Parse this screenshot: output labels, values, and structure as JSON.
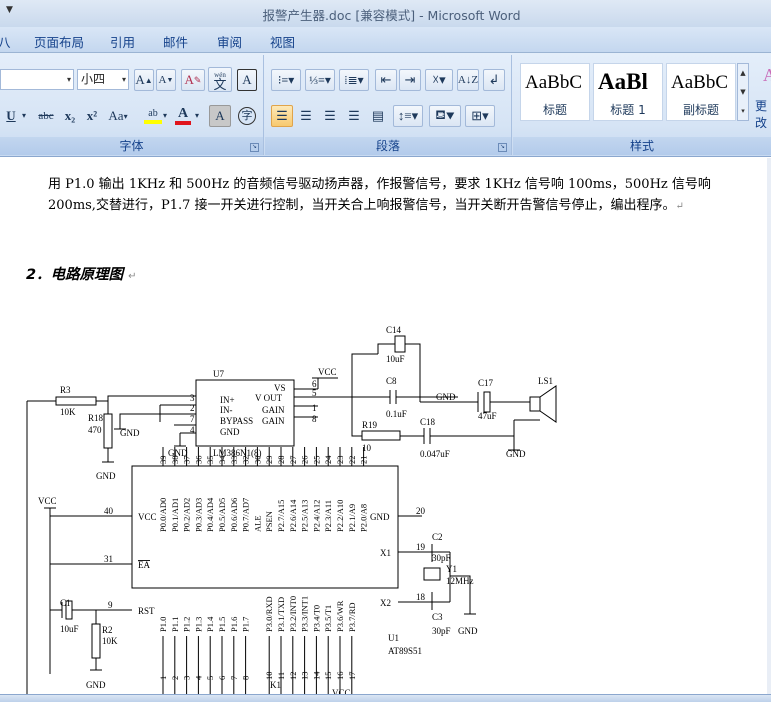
{
  "window": {
    "title": "报警产生器.doc [兼容模式] - Microsoft Word"
  },
  "tabs": [
    "页面布局",
    "引用",
    "邮件",
    "审阅",
    "视图"
  ],
  "ribbon": {
    "font": {
      "label": "字体",
      "size_value": "小四",
      "grow_label": "A",
      "shrink_label": "A",
      "clear_label": "A",
      "phonetic_label": "wén",
      "phonetic_char": "文",
      "border_char_label": "A",
      "underline_label": "U",
      "strike_label": "abc",
      "subscript_label": "x₂",
      "superscript_label": "x²",
      "case_label": "Aa",
      "highlight_label": "ab",
      "fontcolor_label": "A",
      "shade_label": "A",
      "enclose_label": "字"
    },
    "paragraph": {
      "label": "段落"
    },
    "styles": {
      "label": "样式",
      "items": [
        {
          "sample": "AaBbC",
          "name": "标题"
        },
        {
          "sample": "AaBl",
          "name": "标题 1"
        },
        {
          "sample": "AaBbC",
          "name": "副标题"
        }
      ],
      "change_label": "更改"
    }
  },
  "document": {
    "paragraph1": "用 P1.0 输出 1KHz 和 500Hz 的音频信号驱动扬声器，作报警信号，要求 1KHz 信号响 100ms，500Hz 信号响 200ms,交替进行，P1.7 接一开关进行控制，当开关合上响报警信号，当开关断开告警信号停止，编出程序。",
    "heading": "2．电路原理图",
    "pilcrow": "↵",
    "schematic": {
      "labels": {
        "u7": "U7",
        "u7_part": "LM386N1(8)",
        "u7_pins": [
          "IN+",
          "IN-",
          "BYPASS",
          "GND",
          "VS",
          "V OUT",
          "GAIN",
          "GAIN"
        ],
        "u7_pin_nums": [
          "3",
          "2",
          "7",
          "4",
          "6",
          "5",
          "1",
          "8"
        ],
        "vcc": "VCC",
        "gnd": "GND",
        "c14": "C14",
        "c14_val": "10uF",
        "c8": "C8",
        "c8_val": "0.1uF",
        "c17": "C17",
        "c17_val": "47uF",
        "c18": "C18",
        "c18_val": "0.047uF",
        "r19": "R19",
        "r19_val": "10",
        "r3": "R3",
        "r3_val": "10K",
        "r18": "R18",
        "r18_val": "470",
        "ls1": "LS1",
        "u1": "U1",
        "u1_part": "AT89S51",
        "c1": "C1",
        "c1_val": "10uF",
        "r2": "R2",
        "r2_val": "10K",
        "c2": "C2",
        "c2_val": "30pF",
        "c3": "C3",
        "c3_val": "30pF",
        "y1": "Y1",
        "y1_val": "12MHz",
        "k1": "K1",
        "vcc_pin": "VCC",
        "ea_pin": "EA",
        "rst_pin": "RST",
        "gnd_pin": "GND",
        "x1_pin": "X1",
        "x2_pin": "X2",
        "ale_pin": "ALE",
        "psen_pin": "PSEN",
        "p0_pins": [
          "P0.0/AD0",
          "P0.1/AD1",
          "P0.2/AD2",
          "P0.3/AD3",
          "P0.4/AD4",
          "P0.5/AD5",
          "P0.6/AD6",
          "P0.7/AD7"
        ],
        "p2_pins": [
          "P2.7/A15",
          "P2.6/A14",
          "P2.5/A13",
          "P2.4/A12",
          "P2.3/A11",
          "P2.2/A10",
          "P2.1/A9",
          "P2.0/A8"
        ],
        "p1_pins": [
          "P1.0",
          "P1.1",
          "P1.2",
          "P1.3",
          "P1.4",
          "P1.5",
          "P1.6",
          "P1.7"
        ],
        "p3_pins": [
          "P3.0/RXD",
          "P3.1/TXD",
          "P3.2/INT0",
          "P3.3/INT1",
          "P3.4/T0",
          "P3.5/T1",
          "P3.6/WR",
          "P3.7/RD"
        ],
        "top_pin_nums": [
          "39",
          "38",
          "37",
          "36",
          "35",
          "34",
          "33",
          "32",
          "30",
          "29",
          "28",
          "27",
          "26",
          "25",
          "24",
          "23",
          "22",
          "21"
        ],
        "bot_pin_nums": [
          "1",
          "2",
          "3",
          "4",
          "5",
          "6",
          "7",
          "8",
          "10",
          "11",
          "12",
          "13",
          "14",
          "15",
          "16",
          "17"
        ],
        "pin40": "40",
        "pin31": "31",
        "pin9": "9",
        "pin20": "20",
        "pin19": "19",
        "pin18": "18"
      }
    }
  },
  "colors": {
    "accent": "#15428b",
    "ribbon_bg": "#d6e4f5"
  }
}
